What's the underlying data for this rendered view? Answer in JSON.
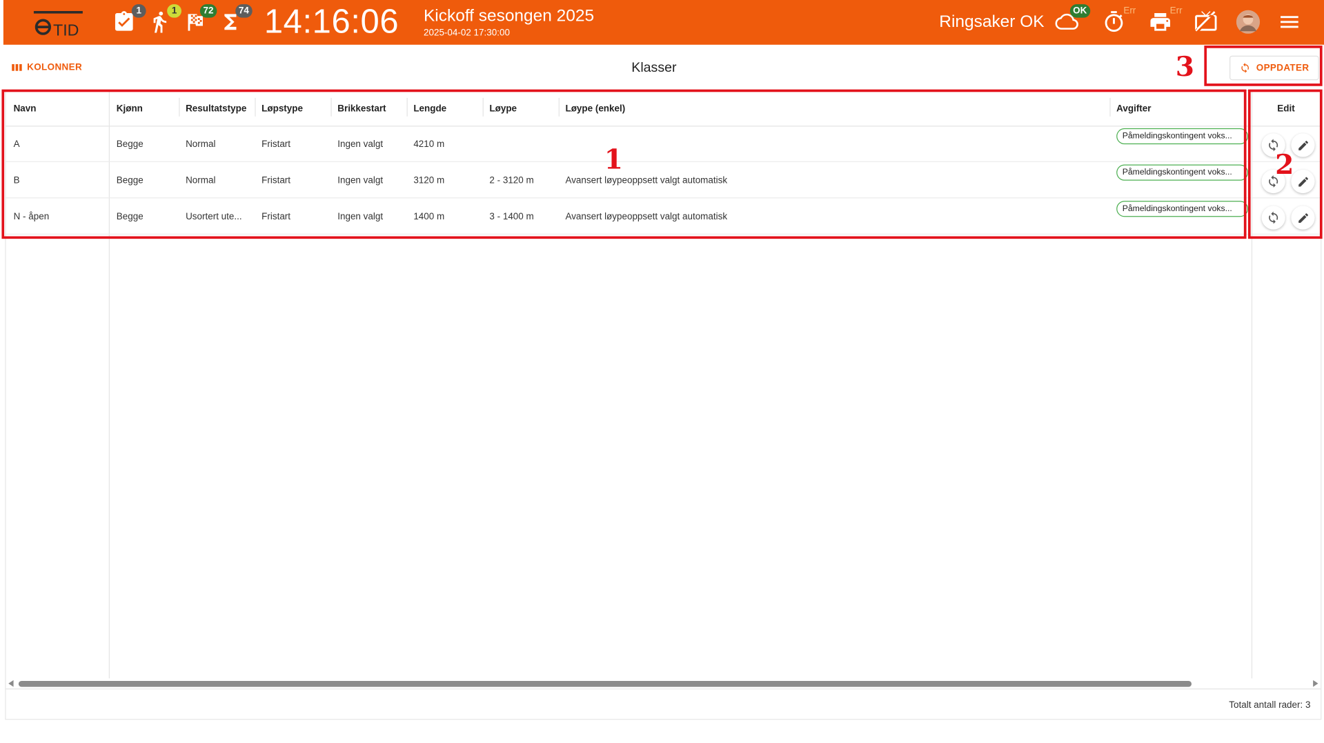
{
  "topbar": {
    "badges": {
      "tasks": "1",
      "runners": "1",
      "finished": "72",
      "total": "74",
      "cloud": "OK",
      "timer": "Err",
      "tv": "Err"
    },
    "clock": "14:16:06",
    "event_title": "Kickoff sesongen 2025",
    "event_date": "2025-04-02 17:30:00",
    "club": "Ringsaker OK"
  },
  "toolbar": {
    "columns_label": "KOLONNER",
    "title": "Klasser",
    "update_label": "OPPDATER"
  },
  "table": {
    "headers": [
      "Navn",
      "Kjønn",
      "Resultatstype",
      "Løpstype",
      "Brikkestart",
      "Lengde",
      "Løype",
      "Løype (enkel)",
      "Avgifter",
      "Edit"
    ],
    "rows": [
      {
        "navn": "A",
        "kjonn": "Begge",
        "resultatstype": "Normal",
        "lopstype": "Fristart",
        "brikkestart": "Ingen valgt",
        "lengde": "4210 m",
        "loype": "",
        "loype_enkel": "",
        "avgifter": "Påmeldingskontingent voks..."
      },
      {
        "navn": "B",
        "kjonn": "Begge",
        "resultatstype": "Normal",
        "lopstype": "Fristart",
        "brikkestart": "Ingen valgt",
        "lengde": "3120 m",
        "loype": "2 - 3120 m",
        "loype_enkel": "Avansert løypeoppsett valgt automatisk",
        "avgifter": "Påmeldingskontingent voks..."
      },
      {
        "navn": "N - åpen",
        "kjonn": "Begge",
        "resultatstype": "Usortert ute...",
        "lopstype": "Fristart",
        "brikkestart": "Ingen valgt",
        "lengde": "1400 m",
        "loype": "3 - 1400 m",
        "loype_enkel": "Avansert løypeoppsett valgt automatisk",
        "avgifter": "Påmeldingskontingent voks..."
      }
    ],
    "total_rows": "Totalt antall rader: 3"
  },
  "annotations": [
    "1",
    "2",
    "3"
  ],
  "colors": {
    "brand": "#ef5b0c",
    "annotation": "#e3121b",
    "chip_border": "#4caf50"
  }
}
